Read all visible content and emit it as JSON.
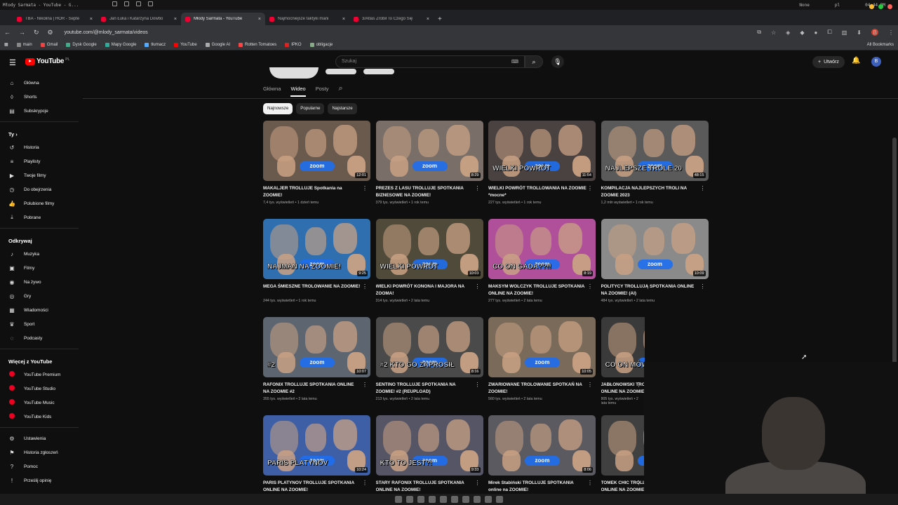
{
  "sys": {
    "window_title": "Młody Sarmata - YouTube - G...",
    "status_user": "None",
    "status_pl": "pl",
    "clock": "04:44 PM"
  },
  "tabs": [
    {
      "title": "TBA - Nikolina | HÖR - Septe"
    },
    {
      "title": "Jan Łuka i Katarzyna Dowbo"
    },
    {
      "title": "Młody Sarmata - YouTube"
    },
    {
      "title": "Najmocniejsze taktyki mani"
    },
    {
      "title": "3/Atlas Zrobił To Czego Się"
    }
  ],
  "address": {
    "url": "youtube.com/@mlody_sarmata/videos",
    "profile_initial": "B"
  },
  "bookmarks": [
    "main",
    "Gmail",
    "Dysk Google",
    "Mapy Google",
    "tłumacz",
    "YouTube",
    "Google AI",
    "Rotten Tomatoes",
    "IPKO",
    "obligacje"
  ],
  "all_bookmarks": "All Bookmarks",
  "youtube": {
    "logo": "YouTube",
    "region": "PL",
    "search_placeholder": "Szukaj",
    "create_label": "Utwórz",
    "avatar_initial": "B"
  },
  "sidebar": {
    "main": [
      {
        "label": "Główna",
        "icon": "home-icon"
      },
      {
        "label": "Shorts",
        "icon": "shorts-icon"
      },
      {
        "label": "Subskrypcje",
        "icon": "subscriptions-icon"
      }
    ],
    "you_header": "Ty  ›",
    "you": [
      {
        "label": "Historia",
        "icon": "history-icon"
      },
      {
        "label": "Playlisty",
        "icon": "playlists-icon"
      },
      {
        "label": "Twoje filmy",
        "icon": "your-videos-icon"
      },
      {
        "label": "Do obejrzenia",
        "icon": "watch-later-icon"
      },
      {
        "label": "Polubione filmy",
        "icon": "liked-icon"
      },
      {
        "label": "Pobrane",
        "icon": "download-icon"
      }
    ],
    "explore_header": "Odkrywaj",
    "explore": [
      {
        "label": "Muzyka",
        "icon": "music-icon"
      },
      {
        "label": "Filmy",
        "icon": "movies-icon"
      },
      {
        "label": "Na żywo",
        "icon": "live-icon"
      },
      {
        "label": "Gry",
        "icon": "gaming-icon"
      },
      {
        "label": "Wiadomości",
        "icon": "news-icon"
      },
      {
        "label": "Sport",
        "icon": "sport-icon"
      },
      {
        "label": "Podcasty",
        "icon": "podcasts-icon"
      }
    ],
    "more_header": "Więcej z YouTube",
    "more": [
      {
        "label": "YouTube Premium"
      },
      {
        "label": "YouTube Studio"
      },
      {
        "label": "YouTube Music"
      },
      {
        "label": "YouTube Kids"
      }
    ],
    "settings": [
      {
        "label": "Ustawienia",
        "icon": "settings-icon"
      },
      {
        "label": "Historia zgłoszeń",
        "icon": "flag-icon"
      },
      {
        "label": "Pomoc",
        "icon": "help-icon"
      },
      {
        "label": "Prześlij opinię",
        "icon": "feedback-icon"
      }
    ]
  },
  "channel_tabs": [
    "Główna",
    "Wideo",
    "Posty"
  ],
  "active_tab": "Wideo",
  "chips": [
    "Najnowsze",
    "Popularne",
    "Najstarsze"
  ],
  "videos": [
    {
      "title": "MAKALJER TROLLUJE Spotkania na ZOOMIE!",
      "meta": "7,4 tys. wyświetleń • 1 dzień temu",
      "duration": "12:01",
      "overlay": "",
      "bg": "#6a5a4e"
    },
    {
      "title": "PREZES Z LASU TROLLUJE SPOTKANIA BIZNESOWE NA ZOOMIE!",
      "meta": "379 tys. wyświetleń • 1 rok temu",
      "duration": "8:29",
      "overlay": "",
      "bg": "#7a6f68"
    },
    {
      "title": "WIELKI POWRÓT TROLLOWANIA NA ZOOMIE *mocne*",
      "meta": "227 tys. wyświetleń • 1 rok temu",
      "duration": "11:54",
      "overlay": "WIELKI POWRÓT",
      "bg": "#4a4240"
    },
    {
      "title": "KOMPILACJA NAJLEPSZYCH TROLI NA ZOOMIE 2023",
      "meta": "1,2 mln wyświetleń • 1 rok temu",
      "duration": "48:15",
      "overlay": "NAJLEPSZE TROLE 20",
      "bg": "#5a5a5a"
    },
    {
      "title": "MEGA ŚMIESZNE TROLOWANIE NA ZOOMIE!",
      "meta": "244 tys. wyświetleń • 1 rok temu",
      "duration": "9:25",
      "overlay": "NAJMAN NA ZOOMIE!",
      "bg": "#2f6fb0"
    },
    {
      "title": "WIELKI POWRÓT KONONA I MAJORA NA ZOOMA!",
      "meta": "314 tys. wyświetleń • 2 lata temu",
      "duration": "10:03",
      "overlay": "WIELKI POWRÓT",
      "bg": "#4f4a3a"
    },
    {
      "title": "MAKSYM WOLCZYK TROLLUJE SPOTKANIA ONLINE NA ZOOMIE!",
      "meta": "277 tys. wyświetleń • 2 lata temu",
      "duration": "8:19",
      "overlay": "CO ON GADA??!!",
      "bg": "#b04f9a"
    },
    {
      "title": "POLITYCY TROLLUJĄ SPOTKANIA ONLINE NA ZOOMIE! (AI)",
      "meta": "484 tys. wyświetleń • 2 lata temu",
      "duration": "10:09",
      "overlay": "",
      "bg": "#8a8a8a"
    },
    {
      "title": "RAFONIX TROLLUJE SPOTKANIA ONLINE NA ZOOMIE #2",
      "meta": "355 tys. wyświetleń • 2 lata temu",
      "duration": "10:07",
      "overlay": "#2",
      "bg": "#5d6670"
    },
    {
      "title": "SENTINO TROLLUJE SPOTKANIA NA ZOOMIE! #2 (REUPLOAD)",
      "meta": "213 tys. wyświetleń • 2 lata temu",
      "duration": "8:16",
      "overlay": "#2 KTO GO ZAPROSIŁ",
      "bg": "#4a4a4a"
    },
    {
      "title": "ZWARIOWANE TROLOWANIE SPOTKAŃ NA ZOOMIE!",
      "meta": "560 tys. wyświetleń • 2 lata temu",
      "duration": "10:05",
      "overlay": "",
      "bg": "#7a6a5a"
    },
    {
      "title": "JABŁONOWSKI TROLLUJE SPOTKANIA ONLINE NA ZOOMIE!",
      "meta": "805 tys. wyświetleń • 2 lata temu",
      "duration": "",
      "overlay": "CO ON MÓWI?!",
      "bg": "#3a3a3a"
    },
    {
      "title": "PARIS PLATYNOV TROLLUJE SPOTKANIA ONLINE NA ZOOMIE!",
      "meta": "",
      "duration": "10:24",
      "overlay": "PARIS PLATYNOV",
      "bg": "#3e5fa5"
    },
    {
      "title": "STARY RAFONIX TROLLUJE SPOTKANIA ONLINE NA ZOOMIE!",
      "meta": "",
      "duration": "9:33",
      "overlay": "KTO TO JEST?!",
      "bg": "#556"
    },
    {
      "title": "Mirek Stabiński TROLLUJE SPOTKANIA online na ZOOMIE!",
      "meta": "",
      "duration": "8:06",
      "overlay": "",
      "bg": "#5a5a60"
    },
    {
      "title": "TOMEK CHIC TROLLUJE SPOTKANIA ONLINE NA ZOOMIE!",
      "meta": "",
      "duration": "",
      "overlay": "",
      "bg": "#404040"
    }
  ],
  "zoom_label": "zoom"
}
